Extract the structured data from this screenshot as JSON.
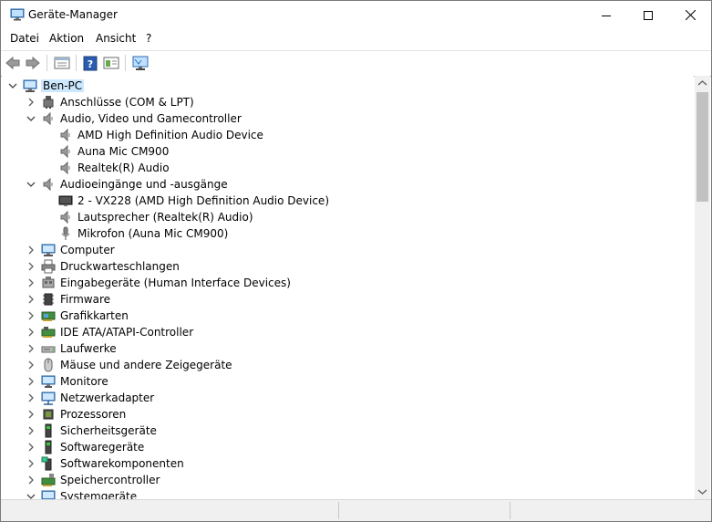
{
  "window": {
    "title": "Geräte-Manager"
  },
  "menu": [
    "Datei",
    "Aktion",
    "Ansicht",
    "?"
  ],
  "toolbar": {
    "buttons": [
      "back-icon",
      "forward-icon",
      "properties-icon",
      "help-icon",
      "view-icon",
      "monitor-scan-icon"
    ]
  },
  "tree": {
    "root": "Ben-PC",
    "nodes": [
      {
        "label": "Anschlüsse (COM & LPT)",
        "level": 1,
        "expanded": false,
        "icon": "port-icon"
      },
      {
        "label": "Audio, Video und Gamecontroller",
        "level": 1,
        "expanded": true,
        "icon": "speaker-icon"
      },
      {
        "label": "AMD High Definition Audio Device",
        "level": 2,
        "icon": "speaker-icon"
      },
      {
        "label": "Auna Mic CM900",
        "level": 2,
        "icon": "speaker-icon"
      },
      {
        "label": "Realtek(R) Audio",
        "level": 2,
        "icon": "speaker-icon"
      },
      {
        "label": "Audioeingänge und -ausgänge",
        "level": 1,
        "expanded": true,
        "icon": "speaker-icon"
      },
      {
        "label": "2 - VX228 (AMD High Definition Audio Device)",
        "level": 2,
        "icon": "display-icon"
      },
      {
        "label": "Lautsprecher (Realtek(R) Audio)",
        "level": 2,
        "icon": "speaker-icon"
      },
      {
        "label": "Mikrofon (Auna Mic CM900)",
        "level": 2,
        "icon": "microphone-icon"
      },
      {
        "label": "Computer",
        "level": 1,
        "expanded": false,
        "icon": "computer-icon"
      },
      {
        "label": "Druckwarteschlangen",
        "level": 1,
        "expanded": false,
        "icon": "printer-icon"
      },
      {
        "label": "Eingabegeräte (Human Interface Devices)",
        "level": 1,
        "expanded": false,
        "icon": "hid-icon"
      },
      {
        "label": "Firmware",
        "level": 1,
        "expanded": false,
        "icon": "chip-icon"
      },
      {
        "label": "Grafikkarten",
        "level": 1,
        "expanded": false,
        "icon": "graphics-card-icon"
      },
      {
        "label": "IDE ATA/ATAPI-Controller",
        "level": 1,
        "expanded": false,
        "icon": "controller-icon"
      },
      {
        "label": "Laufwerke",
        "level": 1,
        "expanded": false,
        "icon": "drive-icon"
      },
      {
        "label": "Mäuse und andere Zeigegeräte",
        "level": 1,
        "expanded": false,
        "icon": "mouse-icon"
      },
      {
        "label": "Monitore",
        "level": 1,
        "expanded": false,
        "icon": "monitor-icon"
      },
      {
        "label": "Netzwerkadapter",
        "level": 1,
        "expanded": false,
        "icon": "network-icon"
      },
      {
        "label": "Prozessoren",
        "level": 1,
        "expanded": false,
        "icon": "cpu-icon"
      },
      {
        "label": "Sicherheitsgeräte",
        "level": 1,
        "expanded": false,
        "icon": "security-icon"
      },
      {
        "label": "Softwaregeräte",
        "level": 1,
        "expanded": false,
        "icon": "software-device-icon"
      },
      {
        "label": "Softwarekomponenten",
        "level": 1,
        "expanded": false,
        "icon": "software-component-icon"
      },
      {
        "label": "Speichercontroller",
        "level": 1,
        "expanded": false,
        "icon": "storage-controller-icon"
      },
      {
        "label": "Systemgeräte",
        "level": 1,
        "expanded": true,
        "icon": "system-icon"
      }
    ]
  },
  "colors": {
    "selection": "#cce8ff",
    "chevron": "#606060",
    "accent": "#1e73c8"
  }
}
